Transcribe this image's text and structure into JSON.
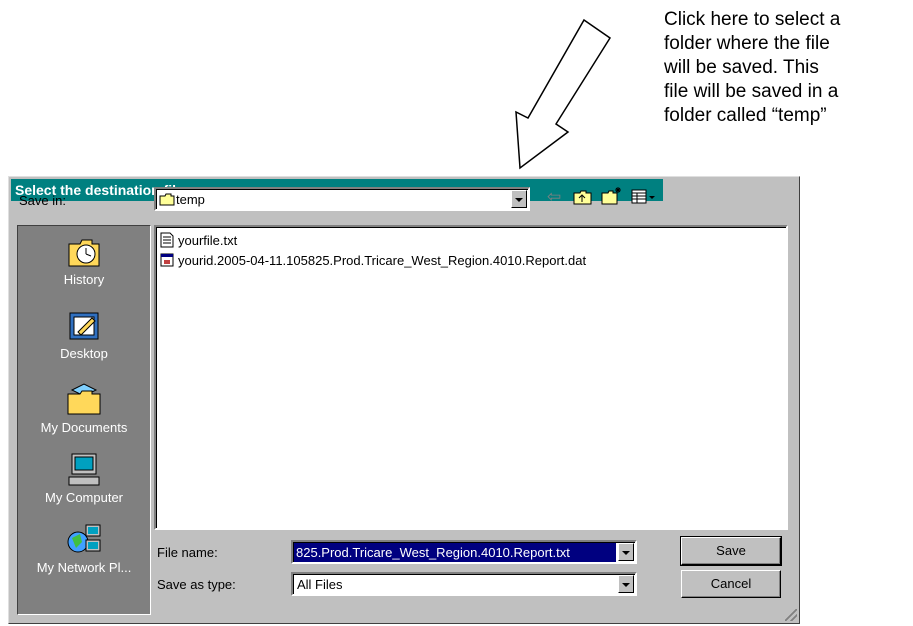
{
  "annotation": {
    "lines": [
      "Click here to select a",
      "folder where the file",
      "will be saved.  This",
      "file will be saved in a",
      "folder called “temp”"
    ]
  },
  "dialog": {
    "title": "Select the destination filename",
    "save_in_label": "Save in:",
    "save_in_value": "temp",
    "places": [
      {
        "label": "History",
        "icon": "history-icon"
      },
      {
        "label": "Desktop",
        "icon": "desktop-icon"
      },
      {
        "label": "My Documents",
        "icon": "my-documents-icon"
      },
      {
        "label": "My Computer",
        "icon": "my-computer-icon"
      },
      {
        "label": "My Network Pl...",
        "icon": "my-network-places-icon"
      }
    ],
    "files": [
      {
        "name": "yourfile.txt",
        "icon": "text-file-icon"
      },
      {
        "name": "yourid.2005-04-11.105825.Prod.Tricare_West_Region.4010.Report.dat",
        "icon": "dat-file-icon"
      }
    ],
    "file_name_label": "File name:",
    "file_name_value": "825.Prod.Tricare_West_Region.4010.Report.txt",
    "save_as_type_label": "Save as type:",
    "save_as_type_value": "All Files",
    "save_button": "Save",
    "cancel_button": "Cancel",
    "colors": {
      "title_bar": "#008080",
      "dialog_face": "#c0c0c0",
      "places_bar": "#808080",
      "selection": "#000080"
    }
  }
}
